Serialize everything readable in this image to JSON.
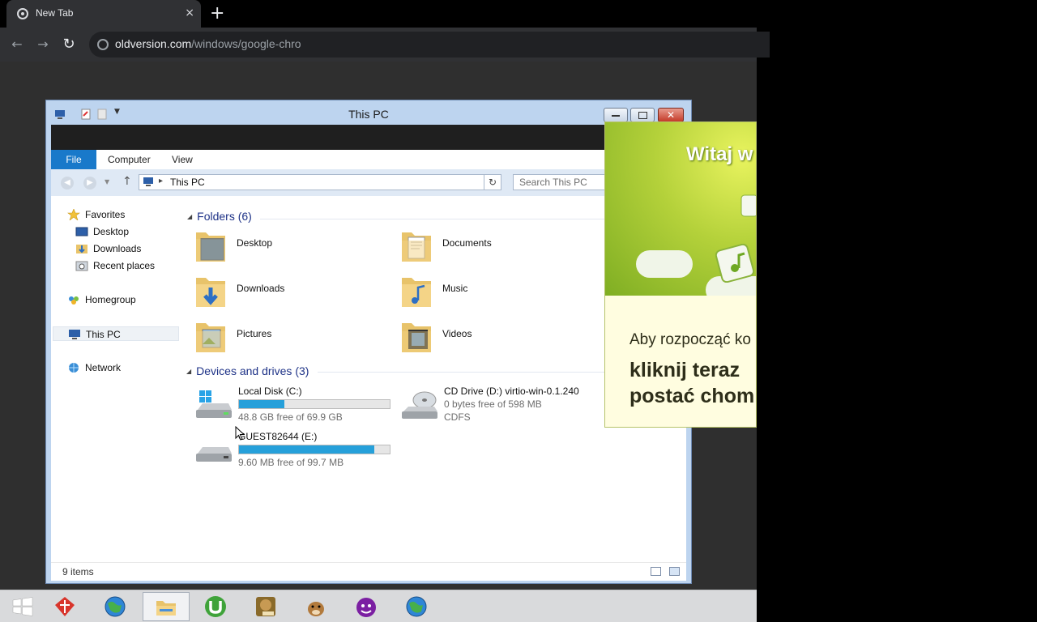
{
  "browser": {
    "tab_title": "New Tab",
    "tab_close": "×",
    "new_tab": "+",
    "back": "←",
    "forward": "→",
    "reload": "↻",
    "url_host": "oldversion.com",
    "url_path": "/windows/google-chro"
  },
  "explorer": {
    "title": "This PC",
    "close_glyph": "✕",
    "ribbon_tabs": [
      "File",
      "Computer",
      "View"
    ],
    "address_path": "This PC",
    "address_sep": "▸",
    "search_placeholder": "Search This PC",
    "nav": {
      "favorites": "Favorites",
      "desktop": "Desktop",
      "downloads": "Downloads",
      "recent": "Recent places",
      "homegroup": "Homegroup",
      "thispc": "This PC",
      "network": "Network"
    },
    "folders_header": "Folders (6)",
    "folders": [
      "Desktop",
      "Documents",
      "Downloads",
      "Music",
      "Pictures",
      "Videos"
    ],
    "devices_header": "Devices and drives (3)",
    "drives": [
      {
        "name": "Local Disk (C:)",
        "free": "48.8 GB free of 69.9 GB",
        "used_fraction": 0.3
      },
      {
        "name": "CD Drive (D:) virtio-win-0.1.240",
        "free": "0 bytes free of 598 MB",
        "fs": "CDFS"
      },
      {
        "name": "GUEST82644 (E:)",
        "free": "9.60 MB free of 99.7 MB",
        "used_fraction": 0.9
      }
    ],
    "status": "9 items"
  },
  "popup": {
    "heading": "Witaj w",
    "line1": "Aby rozpocząć ko",
    "line2": "kliknij teraz",
    "line3": "postać chomi"
  },
  "taskbar": {
    "icons": [
      "windows-start-icon",
      "gift-box-icon",
      "globe-browser-icon",
      "file-explorer-icon",
      "utorrent-icon",
      "game-box-icon",
      "hamster-icon",
      "yahoo-messenger-icon",
      "globe-browser-icon"
    ]
  },
  "colors": {
    "accent": "#1979ca",
    "drive_bar": "#26a0da",
    "header_blue": "#1e3287"
  }
}
